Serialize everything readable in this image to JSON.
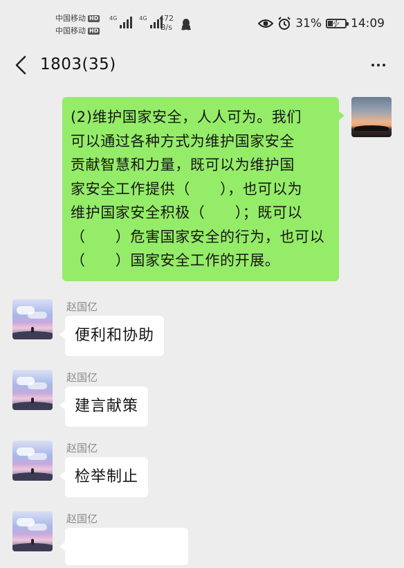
{
  "status_bar": {
    "carrier_1": "中国移动",
    "carrier_2": "中国移动",
    "hd_badge": "HD",
    "network_1": "4G",
    "network_2": "4G",
    "net_speed_value": "472",
    "net_speed_unit": "B/s",
    "battery_percent": "31%",
    "battery_level": 0.31,
    "time": "14:09",
    "icons": [
      "qq-icon",
      "eye-icon",
      "alarm-icon",
      "battery-charging-icon"
    ]
  },
  "header": {
    "title": "1803(35)",
    "back_icon": "chevron-left-icon",
    "more_icon": "more-dots-icon"
  },
  "messages": {
    "outgoing": {
      "lines": [
        "(2)维护国家安全，人人可为。我们",
        "可以通过各种方式为维护国家安全",
        "贡献智慧和力量，既可以为维护国",
        "家安全工作提供（　　），也可以为",
        "维护国家安全积极（　　）；既可以",
        "（　　）危害国家安全的行为，也可以",
        "（　　）国家安全工作的开展。"
      ]
    },
    "incoming": [
      {
        "sender": "赵国亿",
        "text": "便利和协助"
      },
      {
        "sender": "赵国亿",
        "text": "建言献策"
      },
      {
        "sender": "赵国亿",
        "text": "检举制止"
      },
      {
        "sender": "赵国亿",
        "text": ""
      }
    ]
  },
  "colors": {
    "background": "#ededed",
    "outgoing_bubble": "#95ec69",
    "incoming_bubble": "#ffffff",
    "sender_name": "#8a8a8a"
  }
}
